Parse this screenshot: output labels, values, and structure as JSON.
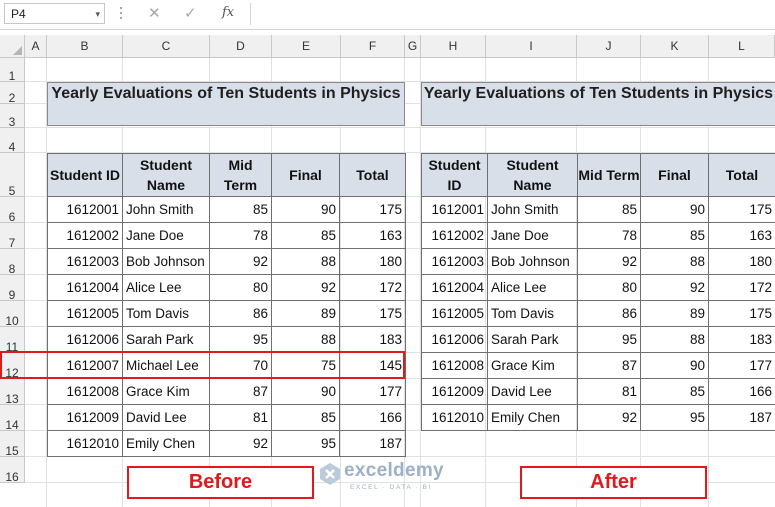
{
  "formula_bar": {
    "name_box": "P4",
    "name_box_arrow": "▾",
    "cancel_symbol": "✕",
    "enter_symbol": "✓",
    "fx_label": "fx",
    "formula": ""
  },
  "sheet": {
    "columns": [
      "A",
      "B",
      "C",
      "D",
      "E",
      "F",
      "G",
      "H",
      "I",
      "J",
      "K",
      "L"
    ],
    "rows": [
      "1",
      "2",
      "3",
      "4",
      "5",
      "6",
      "7",
      "8",
      "9",
      "10",
      "11",
      "12",
      "13",
      "14",
      "15",
      "16"
    ]
  },
  "before_table": {
    "title": "Yearly Evaluations of Ten Students in Physics",
    "headers": [
      "Student ID",
      "Student Name",
      "Mid Term",
      "Final",
      "Total"
    ],
    "rows": [
      [
        "1612001",
        "John Smith",
        "85",
        "90",
        "175"
      ],
      [
        "1612002",
        "Jane Doe",
        "78",
        "85",
        "163"
      ],
      [
        "1612003",
        "Bob Johnson",
        "92",
        "88",
        "180"
      ],
      [
        "1612004",
        "Alice Lee",
        "80",
        "92",
        "172"
      ],
      [
        "1612005",
        "Tom Davis",
        "86",
        "89",
        "175"
      ],
      [
        "1612006",
        "Sarah Park",
        "95",
        "88",
        "183"
      ],
      [
        "1612007",
        "Michael Lee",
        "70",
        "75",
        "145"
      ],
      [
        "1612008",
        "Grace Kim",
        "87",
        "90",
        "177"
      ],
      [
        "1612009",
        "David Lee",
        "81",
        "85",
        "166"
      ],
      [
        "1612010",
        "Emily Chen",
        "92",
        "95",
        "187"
      ]
    ]
  },
  "after_table": {
    "title": "Yearly Evaluations of Ten Students in Physics",
    "headers": [
      "Student ID",
      "Student Name",
      "Mid Term",
      "Final",
      "Total"
    ],
    "rows": [
      [
        "1612001",
        "John Smith",
        "85",
        "90",
        "175"
      ],
      [
        "1612002",
        "Jane Doe",
        "78",
        "85",
        "163"
      ],
      [
        "1612003",
        "Bob Johnson",
        "92",
        "88",
        "180"
      ],
      [
        "1612004",
        "Alice Lee",
        "80",
        "92",
        "172"
      ],
      [
        "1612005",
        "Tom Davis",
        "86",
        "89",
        "175"
      ],
      [
        "1612006",
        "Sarah Park",
        "95",
        "88",
        "183"
      ],
      [
        "1612008",
        "Grace Kim",
        "87",
        "90",
        "177"
      ],
      [
        "1612009",
        "David Lee",
        "81",
        "85",
        "166"
      ],
      [
        "1612010",
        "Emily Chen",
        "92",
        "95",
        "187"
      ]
    ]
  },
  "labels": {
    "before": "Before",
    "after": "After"
  },
  "watermark": {
    "name": "exceldemy",
    "tagline": "EXCEL · DATA · BI"
  },
  "colors": {
    "header_fill": "#d9dfe8",
    "highlight": "#e0191c",
    "grid": "#e1e1e1"
  }
}
